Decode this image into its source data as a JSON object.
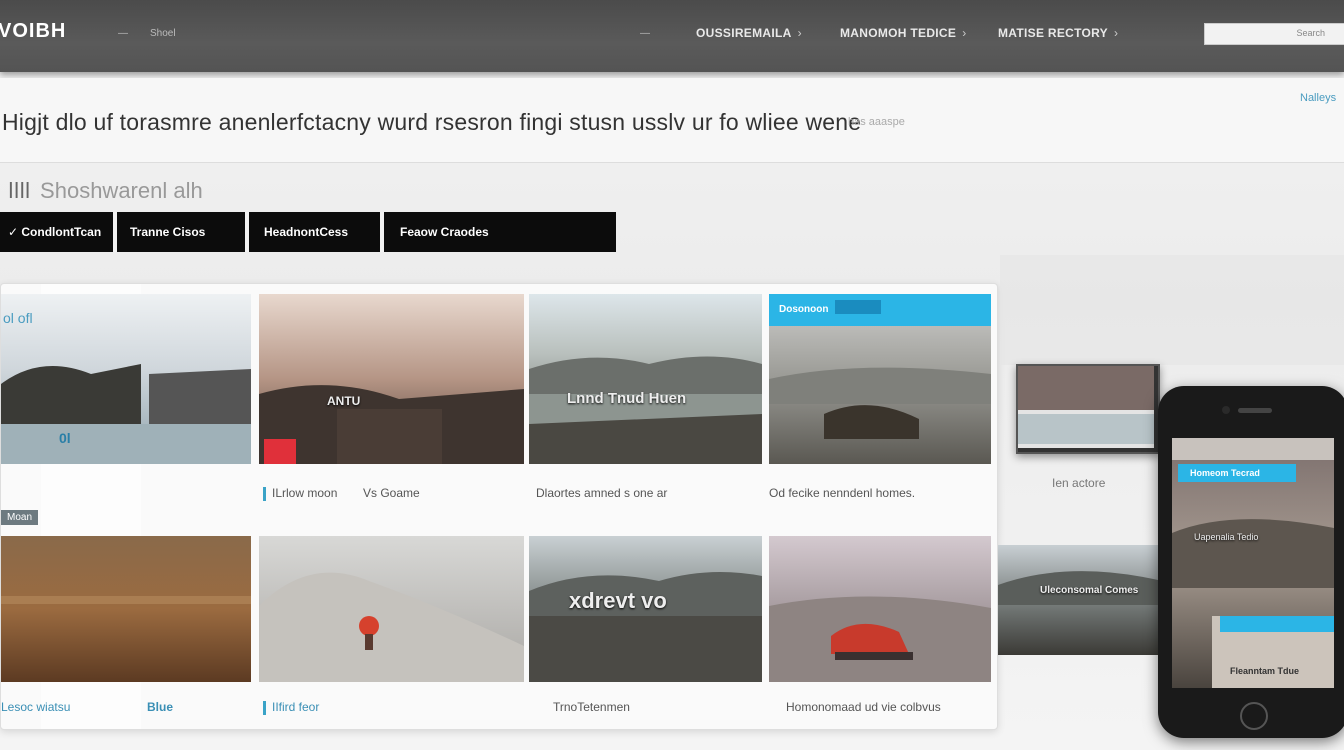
{
  "header": {
    "logo": "VOIBH",
    "small_link_1": "—",
    "small_link_2": "Shoel",
    "small_link_3": "—",
    "nav": [
      {
        "label": "OUSSIREMAILA"
      },
      {
        "label": "MANOMOH TEDICE"
      },
      {
        "label": "MATISE RECTORY"
      }
    ],
    "search_placeholder": "Search"
  },
  "headline": {
    "text": "Higjt dlo uf torasmre anenlerfctacny wurd rsesron fingi stusn usslv ur fo wliee wene",
    "note": "has aaaspe",
    "corner_link": "Nalleys"
  },
  "section": {
    "icon_text": "ǀǀǀl",
    "title": "Shoshwarenl alh"
  },
  "filters": [
    {
      "label": "✓ CondlontTcan"
    },
    {
      "label": "Tranne Cisos"
    },
    {
      "label": "HeadnontCess"
    },
    {
      "label": "Feaow Craodes"
    }
  ],
  "gallery": {
    "row1": [
      {
        "overlay": "ol ofl",
        "badge": "0l"
      },
      {
        "overlay": "ANTU"
      },
      {
        "overlay": "Lnnd Tnud Huen"
      },
      {
        "banner": "Dosonoon"
      }
    ],
    "row1_captions": [
      {
        "text": "ILrlow moon"
      },
      {
        "text": "Vs Goame"
      },
      {
        "text": "Dlaortes amned s one ar"
      },
      {
        "text": "Od fecike nenndenl homes."
      }
    ],
    "mid_badge": "Moan",
    "row2": [
      {
        "overlay": ""
      },
      {
        "overlay": ""
      },
      {
        "overlay": "xdrevt vo"
      },
      {
        "overlay": ""
      }
    ],
    "row2_captions": [
      {
        "text": "Lesoc wiatsu"
      },
      {
        "text": "Blue"
      },
      {
        "text": "IIfird feor"
      },
      {
        "text": "TrnoTetenmen"
      },
      {
        "text": "Homonomaad ud vie colbvus"
      }
    ]
  },
  "devices": {
    "tablet_caption": "Ien actore",
    "side_banner": "Uleconsomal Comes",
    "phone_banner": "Homeom Tecrad",
    "phone_label": "Uapenalia Tedio",
    "phone_bottom": "Fleanntam Tdue"
  }
}
